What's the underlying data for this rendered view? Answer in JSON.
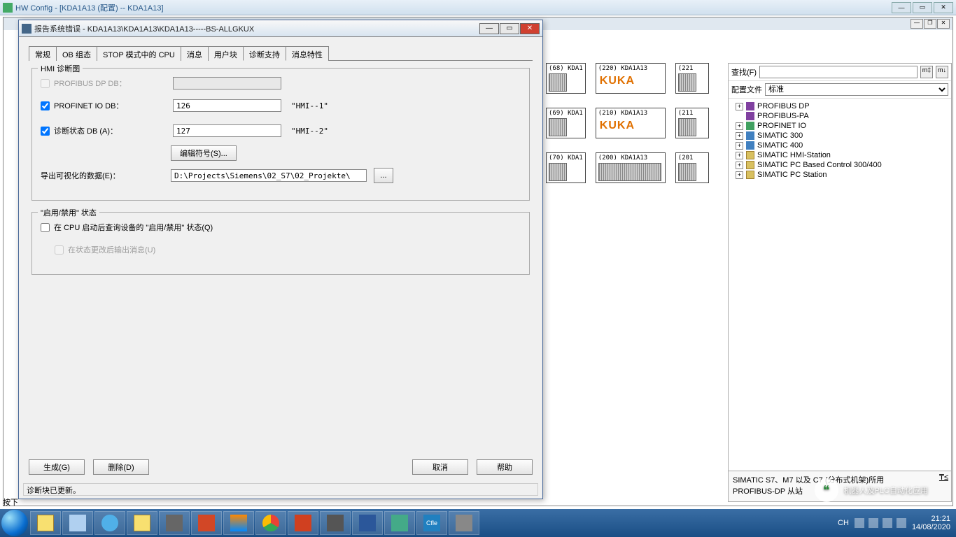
{
  "main_window": {
    "title": "HW Config - [KDA1A13 (配置) -- KDA1A13]"
  },
  "dialog": {
    "title": "报告系统错误 - KDA1A13\\KDA1A13\\KDA1A13-----BS-ALLGKUX",
    "tabs": [
      "常规",
      "OB 组态",
      "STOP 模式中的 CPU",
      "消息",
      "用户块",
      "诊断支持",
      "消息特性"
    ],
    "active_tab": "诊断支持",
    "group1_legend": "HMI 诊断图",
    "profibus_dp_db_label": "PROFIBUS DP DB：",
    "profibus_dp_db_checked": false,
    "profibus_dp_db_value": "",
    "profinet_io_db_label": "PROFINET IO DB：",
    "profinet_io_db_checked": true,
    "profinet_io_db_value": "126",
    "profinet_io_db_right": "\"HMI--1\"",
    "diag_state_db_label": "诊断状态 DB (A)：",
    "diag_state_db_checked": true,
    "diag_state_db_value": "127",
    "diag_state_db_right": "\"HMI--2\"",
    "edit_symbols_btn": "编辑符号(S)...",
    "export_label": "导出可视化的数据(E)：",
    "export_path": "D:\\Projects\\Siemens\\02_S7\\02_Projekte\\",
    "browse_btn": "...",
    "group2_legend": "\"启用/禁用\" 状态",
    "enable_query_label": "在 CPU 启动后查询设备的 \"启用/禁用\" 状态(Q)",
    "enable_query_checked": false,
    "output_msg_label": "在状态更改后输出消息(U)",
    "output_msg_checked": false,
    "generate_btn": "生成(G)",
    "delete_btn": "删除(D)",
    "cancel_btn": "取消",
    "help_btn": "帮助",
    "status": "诊断块已更新。"
  },
  "right_panel": {
    "search_label": "查找(F)",
    "search_value": "",
    "profile_label": "配置文件",
    "profile_value": "标准",
    "tree": [
      "PROFIBUS DP",
      "PROFIBUS-PA",
      "PROFINET IO",
      "SIMATIC 300",
      "SIMATIC 400",
      "SIMATIC HMI-Station",
      "SIMATIC PC Based Control 300/400",
      "SIMATIC PC Station"
    ],
    "footer_line1": "SIMATIC S7、M7 以及 C7 (分布式机架)所用",
    "footer_line2": "PROFIBUS-DP 从站",
    "footer_tau": "₸≤"
  },
  "hw_nodes": {
    "r1": [
      {
        "label": "(68) KDA1"
      },
      {
        "label": "(220) KDA1A13",
        "kuka": true
      },
      {
        "label": "(221"
      }
    ],
    "r2": [
      {
        "label": "(69) KDA1"
      },
      {
        "label": "(210) KDA1A13",
        "kuka": true
      },
      {
        "label": "(211"
      }
    ],
    "r3": [
      {
        "label": "(70) KDA1"
      },
      {
        "label": "(200) KDA1A13"
      },
      {
        "label": "(201"
      }
    ]
  },
  "status_bottom": "按下",
  "taskbar": {
    "ime": "CH",
    "time": "21:21",
    "date": "14/08/2020"
  },
  "watermark": "机器人及PLC自动化应用"
}
